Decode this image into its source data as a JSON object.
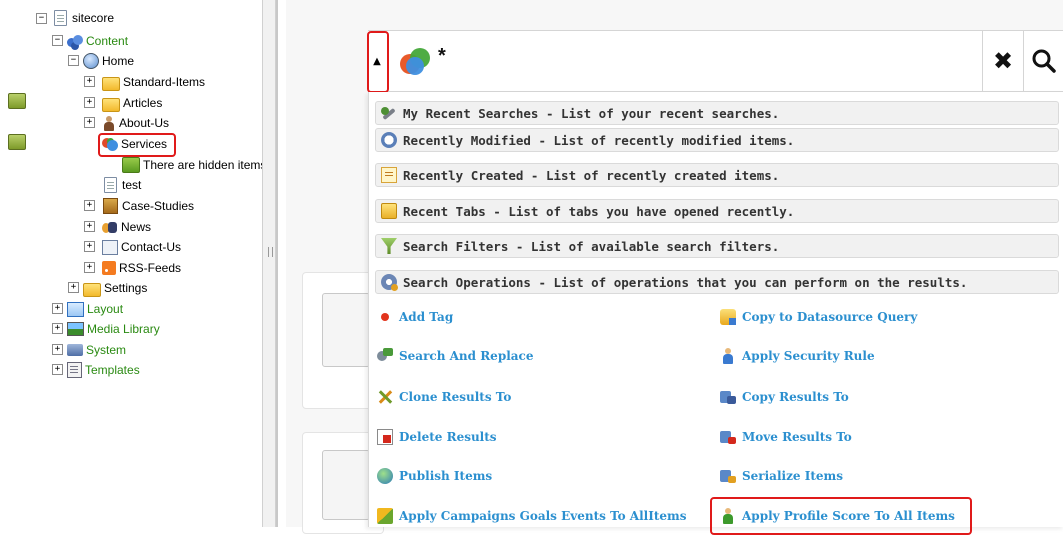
{
  "tree": {
    "nodes": [
      {
        "label": "sitecore",
        "icon": "page-icon",
        "expander": "−",
        "green": false
      },
      {
        "label": "Content",
        "icon": "content-icon",
        "expander": "−",
        "green": true
      },
      {
        "label": "Home",
        "icon": "home-icon",
        "expander": "−",
        "green": false
      },
      {
        "label": "Standard-Items",
        "icon": "folder-icon",
        "expander": "+",
        "green": false
      },
      {
        "label": "Articles",
        "icon": "folder-icon",
        "expander": "+",
        "green": false
      },
      {
        "label": "About-Us",
        "icon": "person-icon",
        "expander": "+",
        "green": false
      },
      {
        "label": "Services",
        "icon": "services-icon",
        "expander": "",
        "green": false
      },
      {
        "label": "There are hidden items",
        "icon": "hidden-items-icon",
        "expander": "",
        "green": false
      },
      {
        "label": "test",
        "icon": "page-icon",
        "expander": "",
        "green": false
      },
      {
        "label": "Case-Studies",
        "icon": "case-studies-icon",
        "expander": "+",
        "green": false
      },
      {
        "label": "News",
        "icon": "news-icon",
        "expander": "+",
        "green": false
      },
      {
        "label": "Contact-Us",
        "icon": "contact-icon",
        "expander": "+",
        "green": false
      },
      {
        "label": "RSS-Feeds",
        "icon": "rss-icon",
        "expander": "+",
        "green": false
      },
      {
        "label": "Settings",
        "icon": "folder-icon",
        "expander": "+",
        "green": false
      },
      {
        "label": "Layout",
        "icon": "layout-icon",
        "expander": "+",
        "green": true
      },
      {
        "label": "Media Library",
        "icon": "media-icon",
        "expander": "+",
        "green": true
      },
      {
        "label": "System",
        "icon": "system-icon",
        "expander": "+",
        "green": true
      },
      {
        "label": "Templates",
        "icon": "templates-icon",
        "expander": "+",
        "green": true
      }
    ]
  },
  "search": {
    "toggle_glyph": "▲",
    "query_text": "*",
    "clear_glyph": "✖"
  },
  "dropdown": {
    "categories": [
      {
        "label": "My Recent Searches - List of your recent searches.",
        "icon": "recent-searches-icon"
      },
      {
        "label": "Recently Modified - List of recently modified items.",
        "icon": "recently-modified-icon"
      },
      {
        "label": "Recently Created - List of recently created items.",
        "icon": "recently-created-icon"
      },
      {
        "label": "Recent Tabs - List of tabs you have opened recently.",
        "icon": "recent-tabs-icon"
      },
      {
        "label": "Search Filters - List of available search filters.",
        "icon": "search-filters-icon"
      },
      {
        "label": "Search Operations - List of operations that you can perform on the results.",
        "icon": "search-operations-icon"
      }
    ],
    "actions_left": [
      {
        "label": "Add Tag",
        "icon": "add-tag-icon"
      },
      {
        "label": "Search And Replace",
        "icon": "search-replace-icon"
      },
      {
        "label": "Clone Results To",
        "icon": "clone-icon"
      },
      {
        "label": "Delete Results",
        "icon": "delete-icon"
      },
      {
        "label": "Publish Items",
        "icon": "publish-icon"
      },
      {
        "label": "Apply Campaigns Goals Events To AllItems",
        "icon": "campaign-icon"
      }
    ],
    "actions_right": [
      {
        "label": "Copy to Datasource Query",
        "icon": "datasource-icon"
      },
      {
        "label": "Apply Security Rule",
        "icon": "security-icon"
      },
      {
        "label": "Copy Results To",
        "icon": "copy-icon"
      },
      {
        "label": "Move Results To",
        "icon": "move-icon"
      },
      {
        "label": "Serialize Items",
        "icon": "serialize-icon"
      },
      {
        "label": "Apply Profile Score To All Items",
        "icon": "profile-score-icon"
      }
    ]
  },
  "colors": {
    "tree_green": "#2a8a12",
    "action_link": "#2b8fcf",
    "highlight_red": "#e01a1a",
    "category_bg": "#f1f1f1"
  }
}
